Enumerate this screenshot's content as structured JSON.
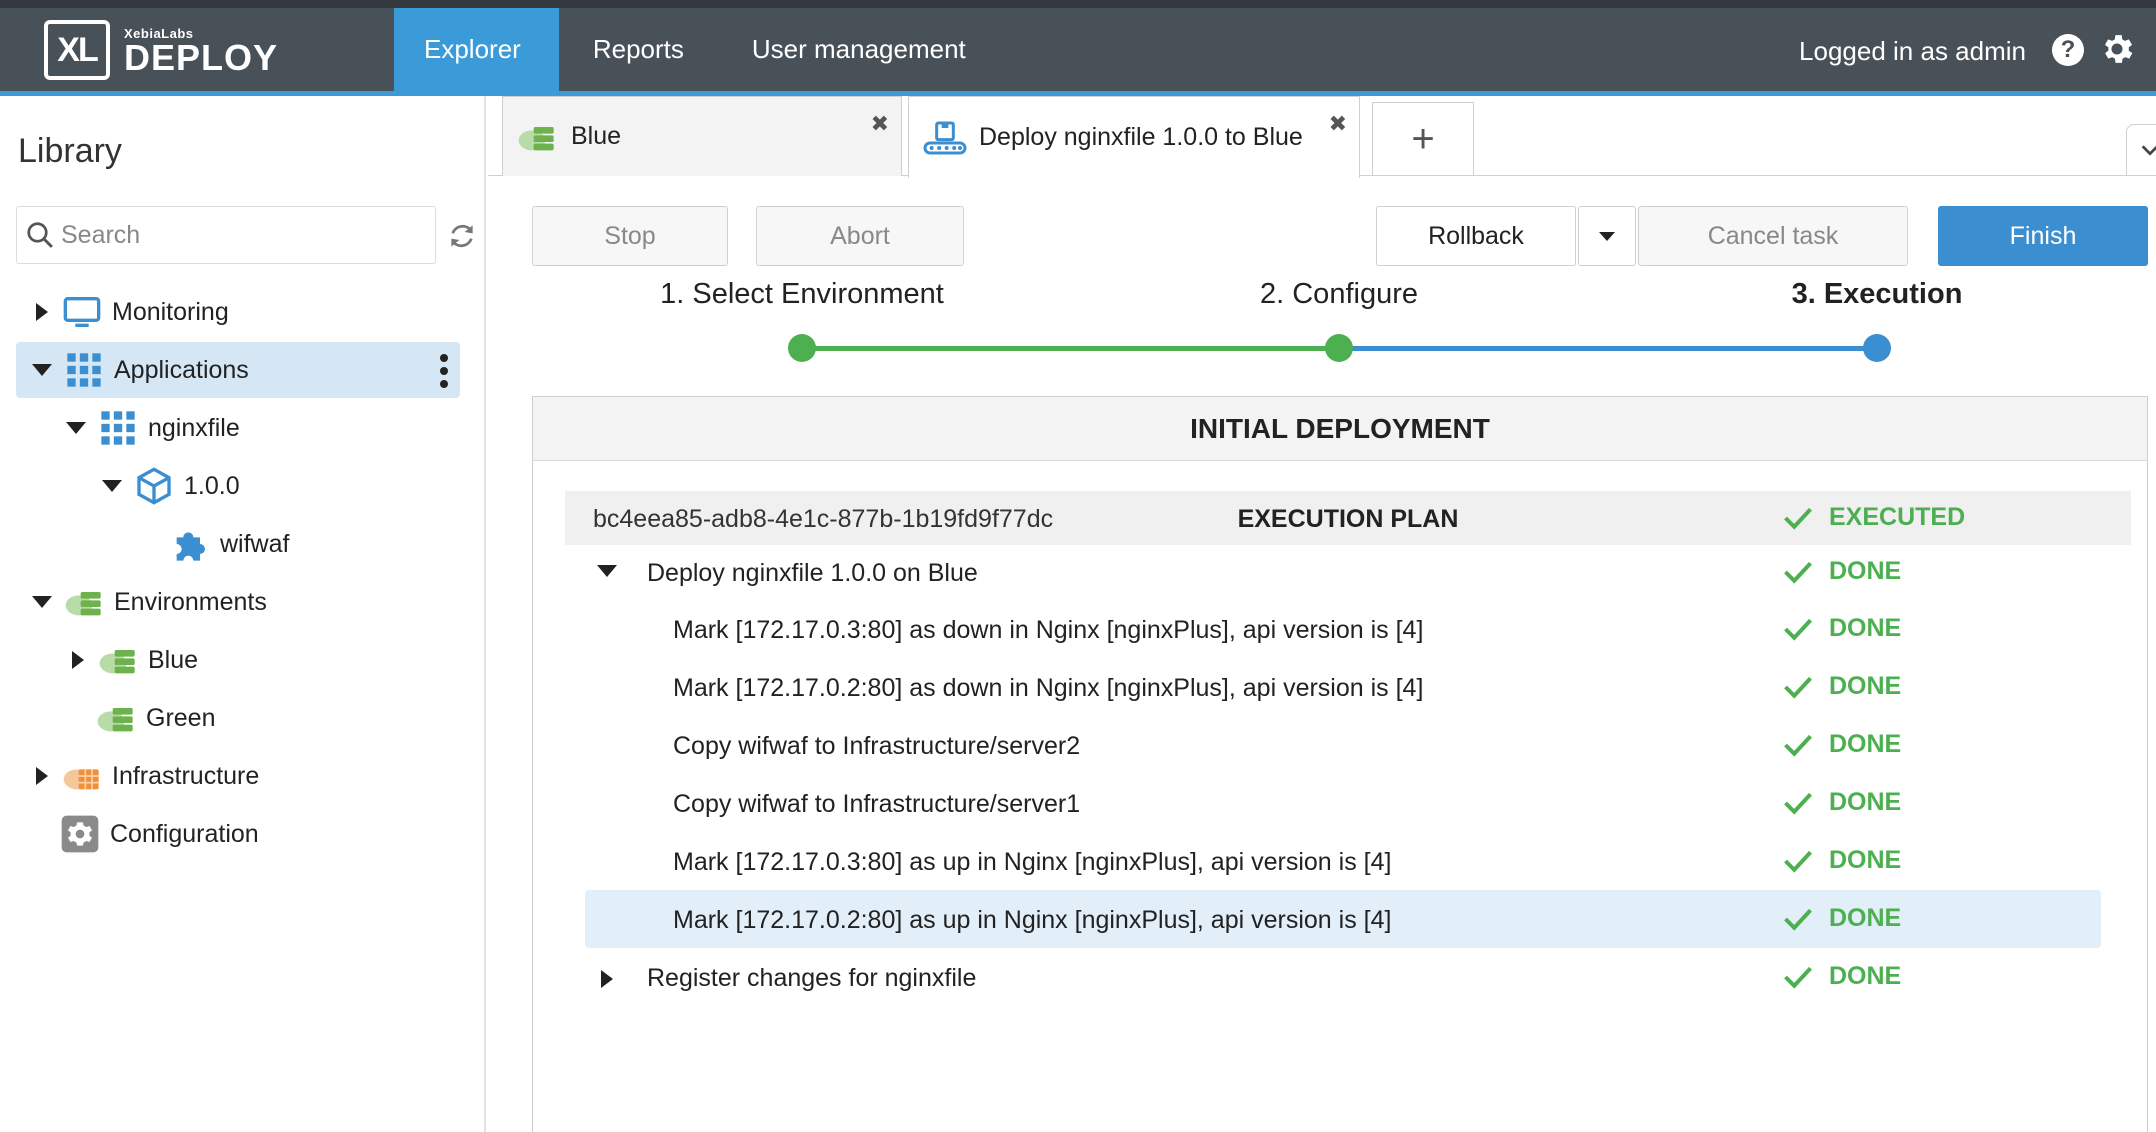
{
  "header": {
    "logo_small": "XebiaLabs",
    "logo_big": "DEPLOY",
    "logo_mark": "XL",
    "nav": [
      "Explorer",
      "Reports",
      "User management"
    ],
    "login_text": "Logged in as admin",
    "help_glyph": "?"
  },
  "sidebar": {
    "title": "Library",
    "search_placeholder": "Search",
    "tree": [
      {
        "label": "Monitoring"
      },
      {
        "label": "Applications"
      },
      {
        "label": "nginxfile"
      },
      {
        "label": "1.0.0"
      },
      {
        "label": "wifwaf"
      },
      {
        "label": "Environments"
      },
      {
        "label": "Blue"
      },
      {
        "label": "Green"
      },
      {
        "label": "Infrastructure"
      },
      {
        "label": "Configuration"
      }
    ]
  },
  "tabs": [
    {
      "label": "Blue"
    },
    {
      "label": "Deploy nginxfile 1.0.0 to Blue"
    }
  ],
  "tab_close_glyph": "✖",
  "tab_add_glyph": "+",
  "toolbar": {
    "stop": "Stop",
    "abort": "Abort",
    "rollback": "Rollback",
    "cancel_task": "Cancel task",
    "finish": "Finish"
  },
  "steps": [
    "1. Select Environment",
    "2. Configure",
    "3. Execution"
  ],
  "panel": {
    "title": "INITIAL DEPLOYMENT",
    "plan_id": "bc4eea85-adb8-4e1c-877b-1b19fd9f77dc",
    "plan_title": "EXECUTION PLAN",
    "plan_status": "EXECUTED"
  },
  "plan_rows": [
    {
      "label": "Deploy nginxfile 1.0.0 on Blue",
      "status": "DONE"
    },
    {
      "label": "Mark [172.17.0.3:80] as down in Nginx [nginxPlus], api version is [4]",
      "status": "DONE"
    },
    {
      "label": "Mark [172.17.0.2:80] as down in Nginx [nginxPlus], api version is [4]",
      "status": "DONE"
    },
    {
      "label": "Copy wifwaf to Infrastructure/server2",
      "status": "DONE"
    },
    {
      "label": "Copy wifwaf to Infrastructure/server1",
      "status": "DONE"
    },
    {
      "label": "Mark [172.17.0.3:80] as up in Nginx [nginxPlus], api version is [4]",
      "status": "DONE"
    },
    {
      "label": "Mark [172.17.0.2:80] as up in Nginx [nginxPlus], api version is [4]",
      "status": "DONE"
    },
    {
      "label": "Register changes for nginxfile",
      "status": "DONE"
    }
  ],
  "colors": {
    "header_bg": "#485058",
    "accent_blue": "#3b9bd9",
    "success_green": "#4caf50",
    "selected_row": "#d5e7f4"
  }
}
